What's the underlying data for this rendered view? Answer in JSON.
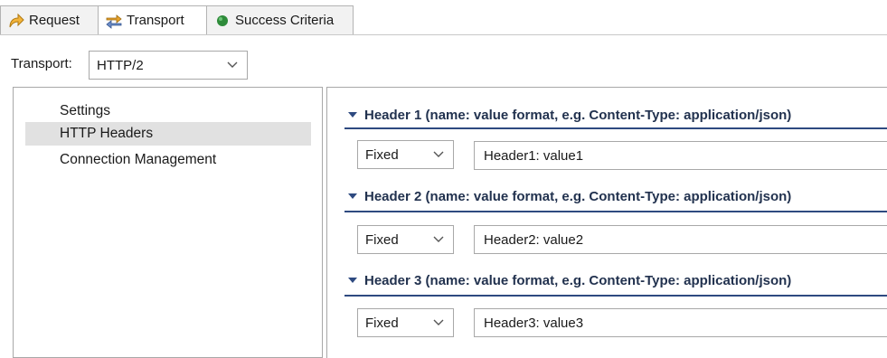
{
  "tabs": [
    {
      "label": "Request",
      "icon": "request-arrow-icon"
    },
    {
      "label": "Transport",
      "icon": "transport-arrows-icon"
    },
    {
      "label": "Success Criteria",
      "icon": "green-dot-icon"
    }
  ],
  "transport": {
    "label": "Transport:",
    "selected": "HTTP/2"
  },
  "nav": {
    "items": [
      {
        "label": "Settings"
      },
      {
        "label": "HTTP Headers",
        "selected": true
      },
      {
        "label": "Connection Management"
      }
    ]
  },
  "headers": [
    {
      "title": "Header 1 (name: value format, e.g. Content-Type: application/json)",
      "mode": "Fixed",
      "value": "Header1: value1"
    },
    {
      "title": "Header 2 (name: value format, e.g. Content-Type: application/json)",
      "mode": "Fixed",
      "value": "Header2: value2"
    },
    {
      "title": "Header 3 (name: value format, e.g. Content-Type: application/json)",
      "mode": "Fixed",
      "value": "Header3: value3"
    }
  ],
  "colors": {
    "section_title": "#22324f",
    "section_line": "#2e4a80",
    "success_dot": "#2e8b3a",
    "selected_row": "#e1e1e1"
  }
}
